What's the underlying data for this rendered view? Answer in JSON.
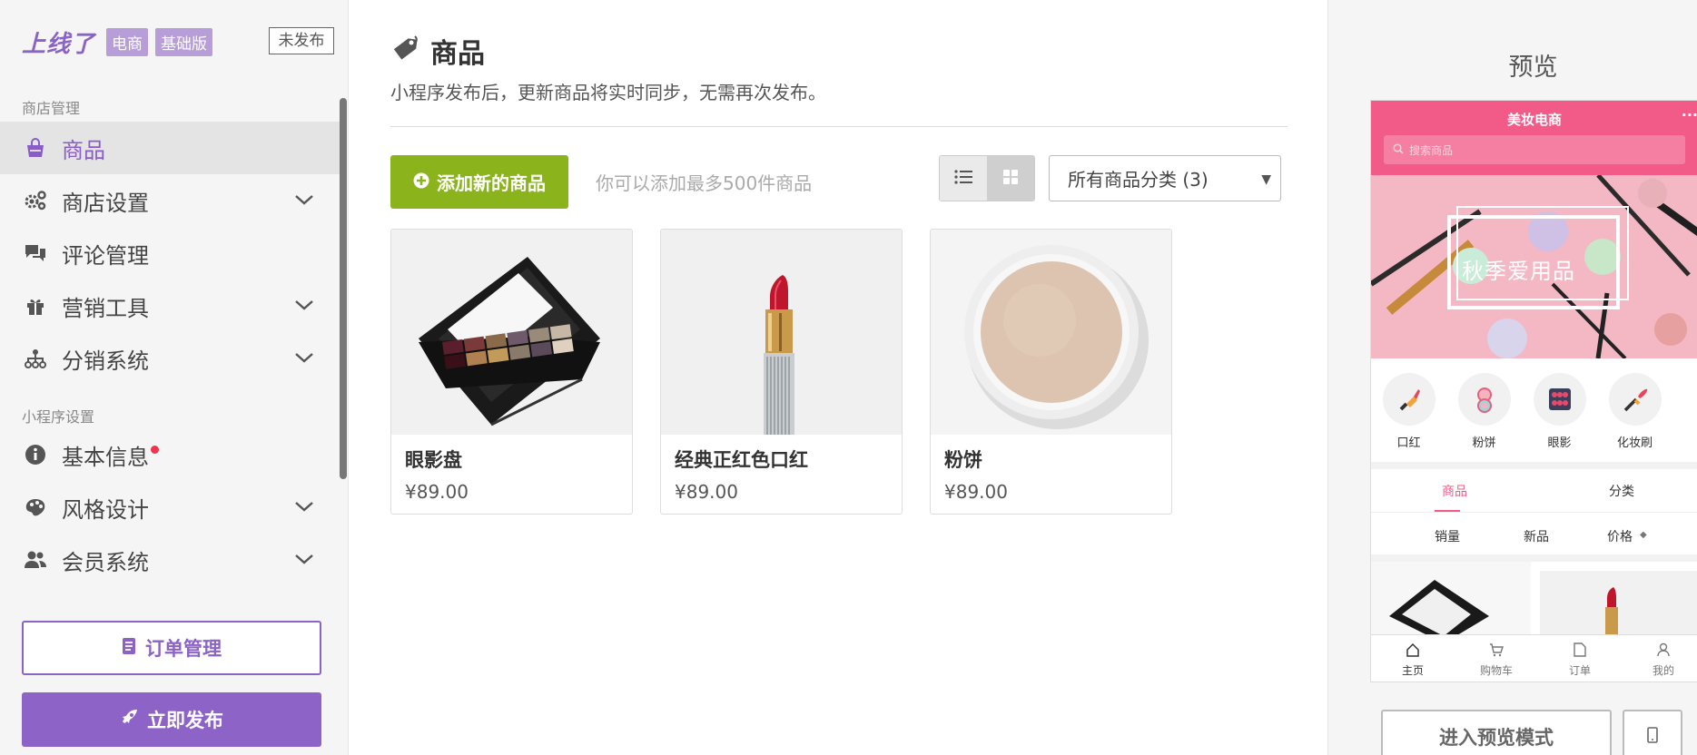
{
  "sidebar": {
    "brand_logo": "上线了",
    "tag_ecommerce": "电商",
    "tag_basic": "基础版",
    "unpublished": "未发布",
    "section_store": "商店管理",
    "section_miniapp": "小程序设置",
    "items": [
      {
        "label": "商品",
        "icon": "shopping-bag-icon",
        "active": true
      },
      {
        "label": "商店设置",
        "icon": "gears-icon",
        "expandable": true
      },
      {
        "label": "评论管理",
        "icon": "comments-icon"
      },
      {
        "label": "营销工具",
        "icon": "gift-icon",
        "expandable": true
      },
      {
        "label": "分销系统",
        "icon": "sitemap-icon",
        "expandable": true
      },
      {
        "label": "基本信息",
        "icon": "info-circle-icon",
        "notification": true
      },
      {
        "label": "风格设计",
        "icon": "palette-icon",
        "expandable": true
      },
      {
        "label": "会员系统",
        "icon": "users-icon",
        "expandable": true
      }
    ],
    "order_button": "订单管理",
    "publish_button": "立即发布"
  },
  "main": {
    "title": "商品",
    "subtitle": "小程序发布后，更新商品将实时同步，无需再次发布。",
    "add_button": "添加新的商品",
    "add_hint": "你可以添加最多500件商品",
    "category_select": "所有商品分类 (3)",
    "products": [
      {
        "name": "眼影盘",
        "price": "¥89.00"
      },
      {
        "name": "经典正红色口红",
        "price": "¥89.00"
      },
      {
        "name": "粉饼",
        "price": "¥89.00"
      }
    ]
  },
  "preview": {
    "title": "预览",
    "phone": {
      "store_title": "美妆电商",
      "more": "···",
      "search_placeholder": "搜索商品",
      "banner_text": "秋季爱用品",
      "categories": [
        "口红",
        "粉饼",
        "眼影",
        "化妆刷"
      ],
      "tabs": [
        "商品",
        "分类"
      ],
      "sorts": [
        "销量",
        "新品",
        "价格"
      ],
      "nav": [
        "主页",
        "购物车",
        "订单",
        "我的"
      ]
    },
    "preview_button": "进入预览模式"
  },
  "colors": {
    "accent_purple": "#8a63c4",
    "add_green": "#8ab31c",
    "phone_pink": "#f25a87"
  }
}
